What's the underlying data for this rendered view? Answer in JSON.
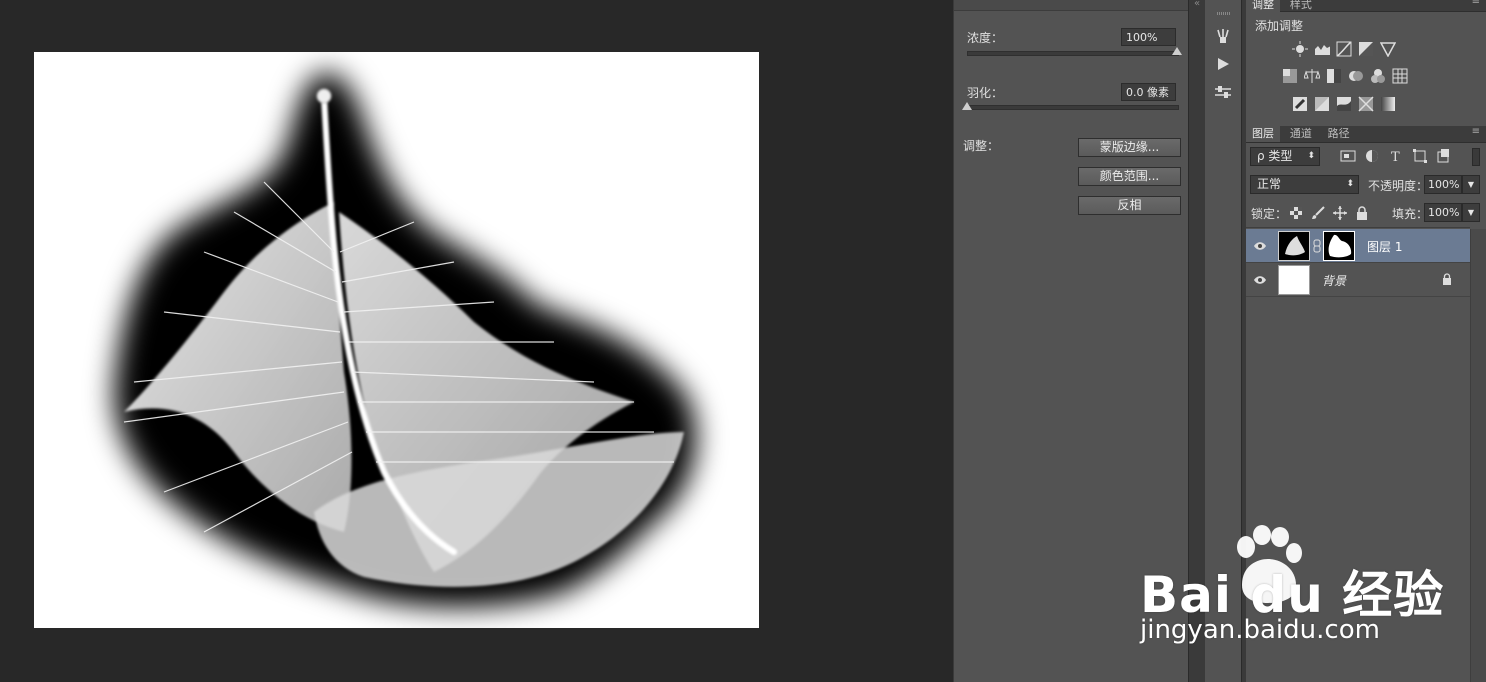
{
  "properties": {
    "density_label": "浓度：",
    "density_value": "100%",
    "density_level": 1.0,
    "feather_label": "羽化：",
    "feather_value": "0.0 像素",
    "feather_level": 0.0,
    "adjust_label": "调整：",
    "buttons": [
      "蒙版边缘...",
      "颜色范围...",
      "反相"
    ]
  },
  "adjustments": {
    "tabs": [
      "调整",
      "样式"
    ],
    "add_label": "添加调整",
    "icon_rows": [
      [
        "brightness-icon",
        "levels-icon",
        "curves-icon",
        "exposure-icon",
        "gradient-triangle-icon"
      ],
      [
        "vibrance-icon",
        "color-balance-icon",
        "black-white-icon",
        "photo-filter-icon",
        "channel-mixer-icon",
        "color-lookup-icon"
      ],
      [
        "invert-icon",
        "posterize-icon",
        "threshold-icon",
        "selective-color-icon",
        "gradient-map-icon"
      ]
    ]
  },
  "layers": {
    "tabs": [
      "图层",
      "通道",
      "路径"
    ],
    "filter_kind": "ρ 类型",
    "blend_mode": "正常",
    "opacity_label": "不透明度：",
    "opacity_value": "100%",
    "lock_label": "锁定：",
    "fill_label": "填充：",
    "fill_value": "100%",
    "items": [
      {
        "name": "图层 1",
        "selected": true,
        "has_mask": true
      },
      {
        "name": "背景",
        "selected": false,
        "locked": true
      }
    ]
  },
  "watermark": {
    "brand": "Bai du 经验",
    "url": "jingyan.baidu.com"
  },
  "colors": {
    "panel": "#535353",
    "canvas_bg": "#282828",
    "selected_layer": "#6b7b93"
  }
}
